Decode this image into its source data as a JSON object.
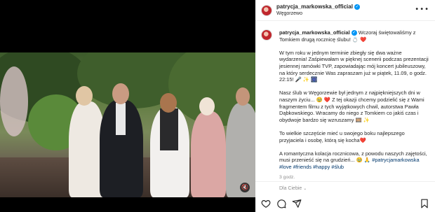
{
  "post": {
    "username": "patrycja_markowska_official",
    "location": "Węgorzewo",
    "more_icon": "more-dots-icon",
    "verified_icon": "verified-badge-icon"
  },
  "caption": {
    "p1": "Wczoraj świętowaliśmy z Tomkiem drugą rocznicę ślubu! 💍 ❤️",
    "p2": "W tym roku w jednym terminie zbiegły się dwa ważne wydarzenia! Zaśpiewałam w pięknej scenerii podczas prezentacji jesiennej ramówki TVP, zapowiadając mój koncert jubileuszowy, na który serdecznie Was zapraszam już w piątek, 11.09, o godz. 22:15! 🎤 ✨ 🎆",
    "p3": "Nasz ślub w Węgorzewie był jednym z najpiękniejszych dni w naszym życiu... 🥹 ❤️ Z tej okazji chcemy podzielić się z Wami fragmentem filmu z tych wyjątkowych chwil, autorstwa Pawła Dąbkowskiego. Wracamy do niego z Tomkiem co jakiś czas i obydwoje bardzo się wzruszamy 🎞️ ✨",
    "p4": "To wielkie szczęście mieć u swojego boku najlepszego przyjaciela i osobę, którą się kocha❤️",
    "p5": "A romantyczna kolacja rocznicowa, z powodu naszych zajętości, musi przenieść się na grudzień... 🥹 🙏 ",
    "mention": "#patrycjamarkowska",
    "hashtags": "#love #friends #happy #ślub",
    "time": "3 godz."
  },
  "footer": {
    "for_you": "Dla Ciebie"
  },
  "actions": {
    "like_icon": "heart-icon",
    "comment_icon": "comment-icon",
    "share_icon": "share-icon",
    "save_icon": "bookmark-icon"
  },
  "media": {
    "mute_icon": "muted-speaker-icon",
    "mute_glyph": "🔇"
  }
}
